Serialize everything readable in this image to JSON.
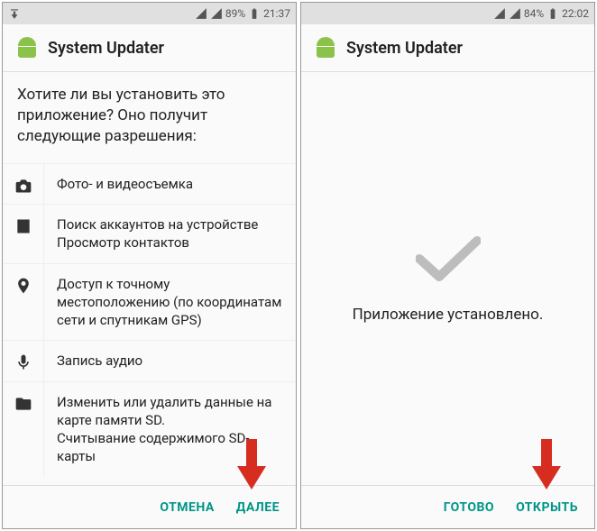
{
  "left": {
    "status": {
      "battery": "89%",
      "time": "21:37"
    },
    "app_title": "System Updater",
    "question": "Хотите ли вы установить это приложение? Оно получит следующие разрешения:",
    "perms": [
      {
        "icon": "camera",
        "lines": [
          "Фото- и видеосъемка"
        ]
      },
      {
        "icon": "contacts",
        "lines": [
          "Поиск аккаунтов на устройстве",
          "Просмотр контактов"
        ]
      },
      {
        "icon": "location",
        "lines": [
          "Доступ к точному местоположению (по координатам сети и спутникам GPS)"
        ]
      },
      {
        "icon": "mic",
        "lines": [
          "Запись аудио"
        ]
      },
      {
        "icon": "folder",
        "lines": [
          "Изменить или удалить данные на карте памяти SD.",
          "Считывание содержимого SD-карты"
        ]
      }
    ],
    "footer": {
      "cancel": "ОТМЕНА",
      "next": "ДАЛЕЕ"
    }
  },
  "right": {
    "status": {
      "battery": "84%",
      "time": "22:02"
    },
    "app_title": "System Updater",
    "installed_text": "Приложение установлено.",
    "footer": {
      "done": "ГОТОВО",
      "open": "ОТКРЫТЬ"
    }
  },
  "colors": {
    "accent": "#009688",
    "arrow": "#d62d20"
  }
}
